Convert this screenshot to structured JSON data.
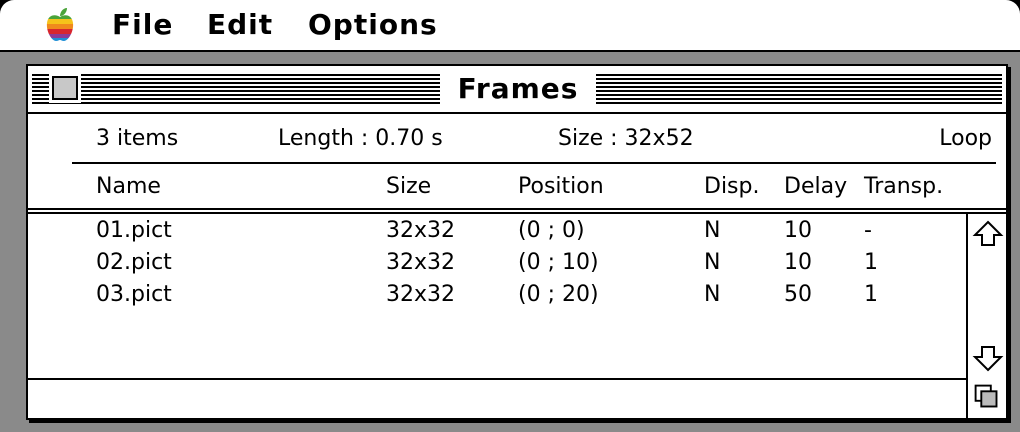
{
  "menubar": {
    "items": [
      "File",
      "Edit",
      "Options"
    ]
  },
  "window": {
    "title": "Frames",
    "info": {
      "items": "3 items",
      "length": "Length : 0.70 s",
      "size": "Size : 32x52",
      "loop": "Loop"
    },
    "columns": [
      "Name",
      "Size",
      "Position",
      "Disp.",
      "Delay",
      "Transp."
    ],
    "rows": [
      [
        "01.pict",
        "32x32",
        "(0 ; 0)",
        "N",
        "10",
        "-"
      ],
      [
        "02.pict",
        "32x32",
        "(0 ; 10)",
        "N",
        "10",
        "1"
      ],
      [
        "03.pict",
        "32x32",
        "(0 ; 20)",
        "N",
        "50",
        "1"
      ]
    ]
  },
  "icons": {
    "apple": "apple-logo-icon",
    "close": "close-box-icon",
    "up": "scroll-up-arrow-icon",
    "down": "scroll-down-arrow-icon",
    "grow": "resize-grow-box-icon"
  },
  "colors": {
    "desktop": "#8a8a8a",
    "window": "#ffffff",
    "ink": "#000000"
  }
}
